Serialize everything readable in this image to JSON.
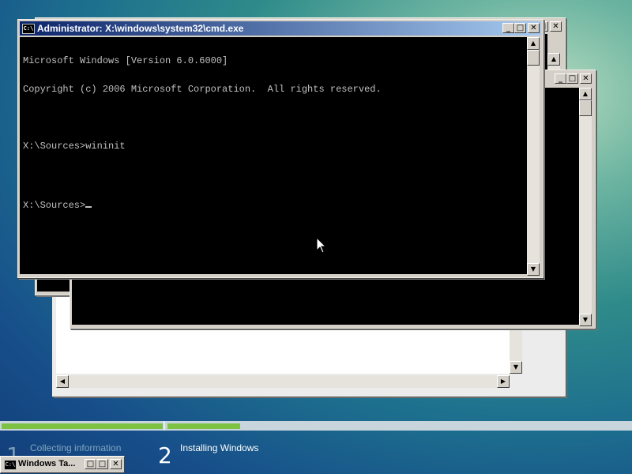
{
  "windows": {
    "main": {
      "title": "Administrator: X:\\windows\\system32\\cmd.exe",
      "icon": "C:\\",
      "lines": [
        "Microsoft Windows [Version 6.0.6000]",
        "Copyright (c) 2006 Microsoft Corporation.  All rights reserved.",
        "",
        "X:\\Sources>wininit",
        "",
        "X:\\Sources>"
      ]
    }
  },
  "buttons": {
    "minimize": "_",
    "maximize": "□",
    "close": "✕"
  },
  "scroll_arrows": {
    "up": "▲",
    "down": "▼",
    "left": "◀",
    "right": "▶"
  },
  "setup": {
    "steps": [
      {
        "number": "1",
        "label": "Collecting information"
      },
      {
        "number": "2",
        "label": "Installing Windows"
      }
    ]
  },
  "taskbar": {
    "item_label": "Windows Ta..."
  }
}
